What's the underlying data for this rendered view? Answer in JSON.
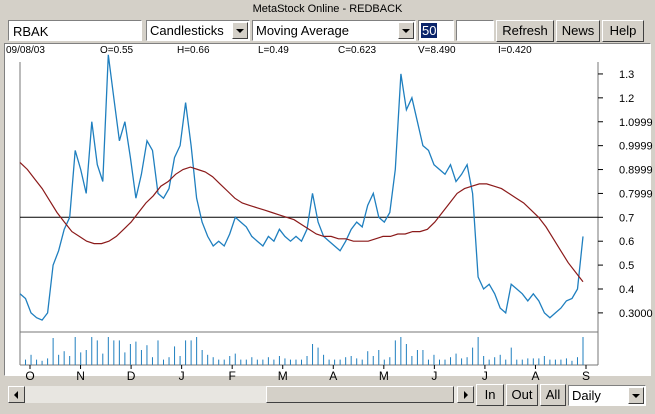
{
  "app": {
    "title": "MetaStock Online - REDBACK"
  },
  "toolbar": {
    "symbol": "RBAK",
    "chart_style": "Candlesticks",
    "indicator": "Moving Average",
    "period": "50",
    "extra_value": "",
    "refresh_label": "Refresh",
    "news_label": "News",
    "help_label": "Help"
  },
  "info_bar": {
    "date": "09/08/03",
    "open": "O=0.55",
    "high": "H=0.66",
    "low": "L=0.49",
    "close": "C=0.623",
    "volume": "V=8.490",
    "interest": "I=0.420"
  },
  "bottom": {
    "in_label": "In",
    "out_label": "Out",
    "all_label": "All",
    "period_selected": "Daily"
  },
  "colors": {
    "price": "#1f7fbf",
    "moving_average": "#8b1a1a",
    "reference_line": "#000000"
  },
  "chart_data": {
    "type": "line",
    "ylabels": [
      "1.3",
      "1.2",
      "1.0999",
      "0.9999",
      "0.8999",
      "0.7999",
      "0.7",
      "0.6",
      "0.5",
      "0.4",
      "0.3000"
    ],
    "xlabels": [
      "O",
      "N",
      "D",
      "J",
      "F",
      "M",
      "A",
      "M",
      "J",
      "J",
      "A",
      "S"
    ],
    "reference_value": 0.7,
    "series": [
      {
        "role": "price",
        "values": [
          0.38,
          0.36,
          0.3,
          0.28,
          0.27,
          0.3,
          0.5,
          0.56,
          0.65,
          0.7,
          0.98,
          0.9,
          0.8,
          1.1,
          0.92,
          0.85,
          1.38,
          1.2,
          1.02,
          1.1,
          0.95,
          0.78,
          0.88,
          1.02,
          0.98,
          0.8,
          0.78,
          0.82,
          0.95,
          1.0,
          1.18,
          1.0,
          0.78,
          0.68,
          0.62,
          0.58,
          0.6,
          0.58,
          0.63,
          0.7,
          0.68,
          0.66,
          0.62,
          0.6,
          0.58,
          0.62,
          0.6,
          0.65,
          0.62,
          0.6,
          0.62,
          0.6,
          0.65,
          0.8,
          0.68,
          0.62,
          0.6,
          0.58,
          0.56,
          0.6,
          0.65,
          0.68,
          0.66,
          0.75,
          0.8,
          0.7,
          0.68,
          0.72,
          0.9,
          1.3,
          1.15,
          1.2,
          1.1,
          1.0,
          0.98,
          0.92,
          0.9,
          0.88,
          0.92,
          0.85,
          0.88,
          0.92,
          0.8,
          0.45,
          0.4,
          0.42,
          0.38,
          0.32,
          0.3,
          0.42,
          0.4,
          0.38,
          0.35,
          0.38,
          0.35,
          0.3,
          0.28,
          0.3,
          0.32,
          0.35,
          0.36,
          0.4,
          0.62
        ]
      },
      {
        "role": "moving_average",
        "values": [
          0.93,
          0.9,
          0.86,
          0.82,
          0.77,
          0.72,
          0.68,
          0.64,
          0.62,
          0.6,
          0.59,
          0.59,
          0.6,
          0.62,
          0.65,
          0.68,
          0.72,
          0.76,
          0.79,
          0.83,
          0.85,
          0.88,
          0.9,
          0.91,
          0.9,
          0.89,
          0.87,
          0.84,
          0.81,
          0.78,
          0.76,
          0.75,
          0.74,
          0.73,
          0.72,
          0.71,
          0.7,
          0.69,
          0.67,
          0.65,
          0.63,
          0.62,
          0.62,
          0.61,
          0.61,
          0.6,
          0.6,
          0.6,
          0.61,
          0.62,
          0.62,
          0.63,
          0.63,
          0.64,
          0.64,
          0.65,
          0.68,
          0.72,
          0.76,
          0.8,
          0.82,
          0.83,
          0.84,
          0.84,
          0.83,
          0.82,
          0.8,
          0.78,
          0.76,
          0.73,
          0.7,
          0.66,
          0.61,
          0.56,
          0.51,
          0.47,
          0.43
        ]
      }
    ]
  }
}
